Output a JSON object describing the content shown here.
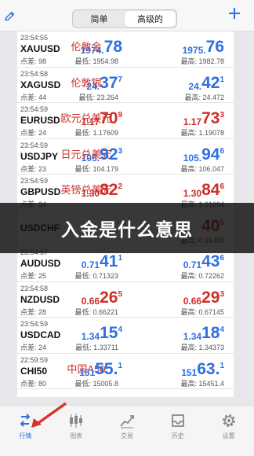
{
  "header": {
    "segments": [
      {
        "label": "简单",
        "active": false
      },
      {
        "label": "高级的",
        "active": true
      }
    ],
    "edit_icon": "pencil-icon",
    "add_icon": "plus-icon"
  },
  "quotes": [
    {
      "time": "23:54:55",
      "symbol": "XAUUSD",
      "spread": "点差: 98",
      "cn": "伦敦金",
      "bid": {
        "a": "1974.",
        "b": "78",
        "c": ""
      },
      "ask": {
        "a": "1975.",
        "b": "76",
        "c": ""
      },
      "bid_color": "blue",
      "ask_color": "blue",
      "low": "最低: 1954.98",
      "high": "最高: 1982.78"
    },
    {
      "time": "23:54:58",
      "symbol": "XAGUSD",
      "spread": "点差: 44",
      "cn": "伦敦银",
      "bid": {
        "a": "24.",
        "b": "37",
        "c": "7"
      },
      "ask": {
        "a": "24.",
        "b": "42",
        "c": "1"
      },
      "bid_color": "blue",
      "ask_color": "blue",
      "low": "最低: 23.264",
      "high": "最高: 24.472"
    },
    {
      "time": "23:54:59",
      "symbol": "EURUSD",
      "spread": "点差: 24",
      "cn": "欧元兑美元",
      "bid": {
        "a": "1.17",
        "b": "70",
        "c": "9"
      },
      "ask": {
        "a": "1.17",
        "b": "73",
        "c": "3"
      },
      "bid_color": "red",
      "ask_color": "red",
      "low": "最低: 1.17609",
      "high": "最高: 1.19078"
    },
    {
      "time": "23:54:59",
      "symbol": "USDJPY",
      "spread": "点差: 23",
      "cn": "日元兑美元",
      "bid": {
        "a": "105.",
        "b": "92",
        "c": "3"
      },
      "ask": {
        "a": "105.",
        "b": "94",
        "c": "6"
      },
      "bid_color": "blue",
      "ask_color": "blue",
      "low": "最低: 104.179",
      "high": "最高: 106.047"
    },
    {
      "time": "23:54:59",
      "symbol": "GBPUSD",
      "spread": "点差: 24",
      "cn": "英镑兑美元",
      "bid": {
        "a": "1.30",
        "b": "82",
        "c": "2"
      },
      "ask": {
        "a": "1.30",
        "b": "84",
        "c": "6"
      },
      "bid_color": "red",
      "ask_color": "red",
      "low": "",
      "high": "最高: 1.31694"
    },
    {
      "time": "",
      "symbol": "USDCHF",
      "spread": "",
      "cn": "",
      "bid": {
        "a": "",
        "b": "",
        "c": ""
      },
      "ask": {
        "a": "",
        "b": "40",
        "c": "5"
      },
      "bid_color": "red",
      "ask_color": "red",
      "low": "",
      "high": "最高: 0.91480"
    },
    {
      "time": "23:54:57",
      "symbol": "AUDUSD",
      "spread": "点差: 25",
      "cn": "",
      "bid": {
        "a": "0.71",
        "b": "41",
        "c": "1"
      },
      "ask": {
        "a": "0.71",
        "b": "43",
        "c": "6"
      },
      "bid_color": "blue",
      "ask_color": "blue",
      "low": "最低: 0.71323",
      "high": "最高: 0.72262"
    },
    {
      "time": "23:54:58",
      "symbol": "NZDUSD",
      "spread": "点差: 28",
      "cn": "",
      "bid": {
        "a": "0.66",
        "b": "26",
        "c": "5"
      },
      "ask": {
        "a": "0.66",
        "b": "29",
        "c": "3"
      },
      "bid_color": "red",
      "ask_color": "red",
      "low": "最低: 0.66221",
      "high": "最高: 0.67145"
    },
    {
      "time": "23:54:59",
      "symbol": "USDCAD",
      "spread": "点差: 24",
      "cn": "",
      "bid": {
        "a": "1.34",
        "b": "15",
        "c": "4"
      },
      "ask": {
        "a": "1.34",
        "b": "18",
        "c": "4"
      },
      "bid_color": "blue",
      "ask_color": "blue",
      "low": "最低: 1.33711",
      "high": "最高: 1.34373"
    },
    {
      "time": "22:59:59",
      "symbol": "CHI50",
      "spread": "点差: 80",
      "cn": "中国A50",
      "bid": {
        "a": "151",
        "b": "55.",
        "c": "1"
      },
      "ask": {
        "a": "151",
        "b": "63.",
        "c": "1"
      },
      "bid_color": "blue",
      "ask_color": "blue",
      "low": "最低: 15005.8",
      "high": "最高: 15451.4"
    }
  ],
  "banner": {
    "text": "入金是什么意思"
  },
  "tabs": [
    {
      "label": "行情",
      "icon": "quotes-arrows-icon",
      "active": true
    },
    {
      "label": "图表",
      "icon": "candlestick-chart-icon",
      "active": false
    },
    {
      "label": "交易",
      "icon": "trade-chart-icon",
      "active": false
    },
    {
      "label": "历史",
      "icon": "inbox-history-icon",
      "active": false
    },
    {
      "label": "设置",
      "icon": "gear-icon",
      "active": false
    }
  ],
  "colors": {
    "blue": "#2f6fe0",
    "red": "#cc2e28",
    "annotation_arrow": "#d9342b"
  }
}
